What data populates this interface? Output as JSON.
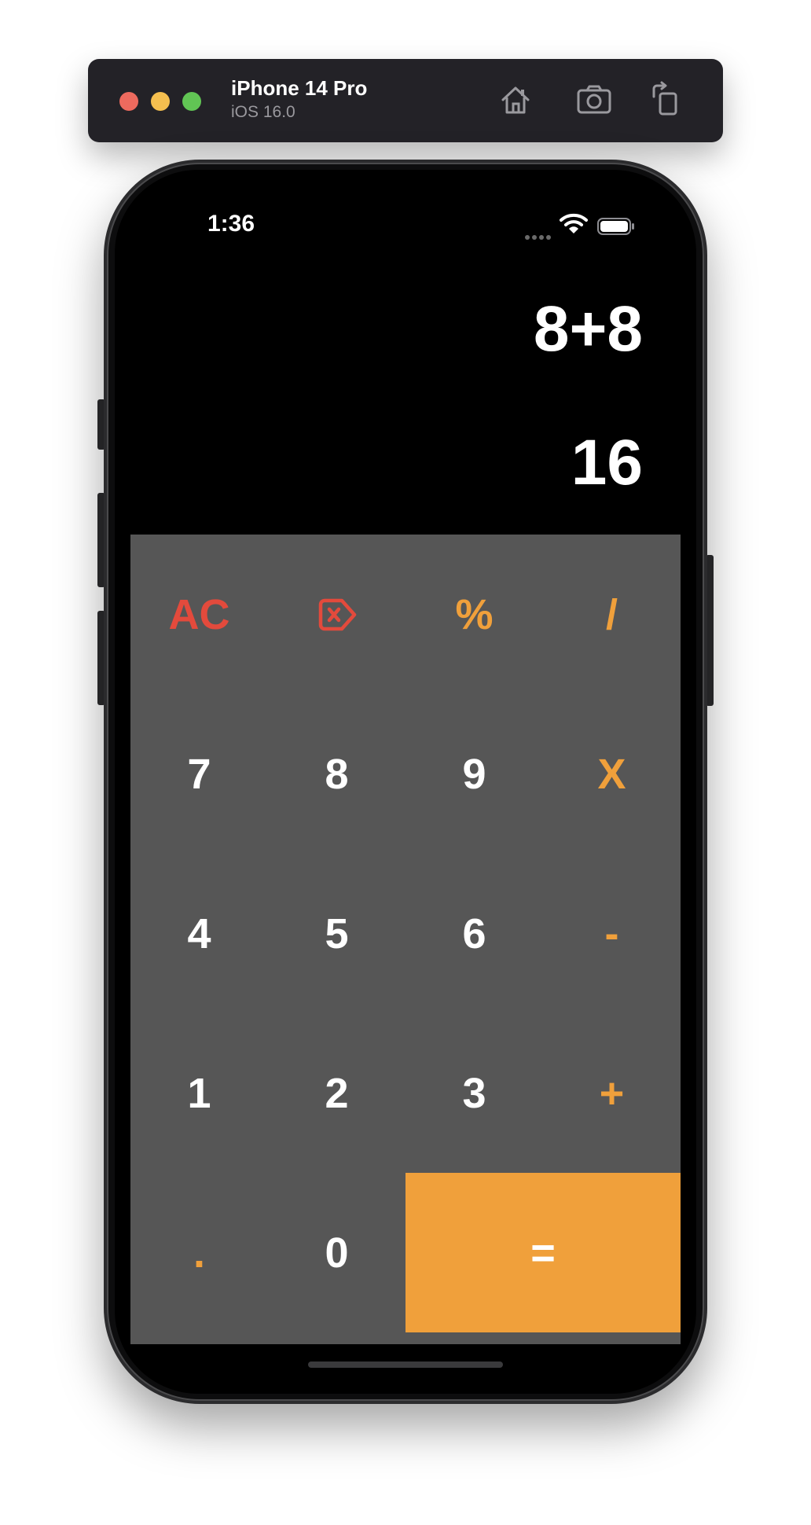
{
  "simulator": {
    "device_name": "iPhone 14 Pro",
    "os_version": "iOS 16.0",
    "icons": [
      "home-icon",
      "screenshot-icon",
      "rotate-icon"
    ]
  },
  "status_bar": {
    "time": "1:36",
    "icons": [
      "cellular-icon",
      "wifi-icon",
      "battery-icon"
    ]
  },
  "display": {
    "expression": "8+8",
    "result": "16"
  },
  "keypad": {
    "row1": {
      "clear": "AC",
      "backspace_icon": "backspace-icon",
      "percent": "%",
      "divide": "/"
    },
    "row2": {
      "k7": "7",
      "k8": "8",
      "k9": "9",
      "multiply": "X"
    },
    "row3": {
      "k4": "4",
      "k5": "5",
      "k6": "6",
      "subtract": "-"
    },
    "row4": {
      "k1": "1",
      "k2": "2",
      "k3": "3",
      "add": "+"
    },
    "row5": {
      "decimal": ".",
      "k0": "0",
      "equals": "="
    }
  },
  "colors": {
    "operator": "#f0a03b",
    "clear": "#e34a3c",
    "keypad_bg": "#565656",
    "equals_bg": "#f0a03b"
  }
}
